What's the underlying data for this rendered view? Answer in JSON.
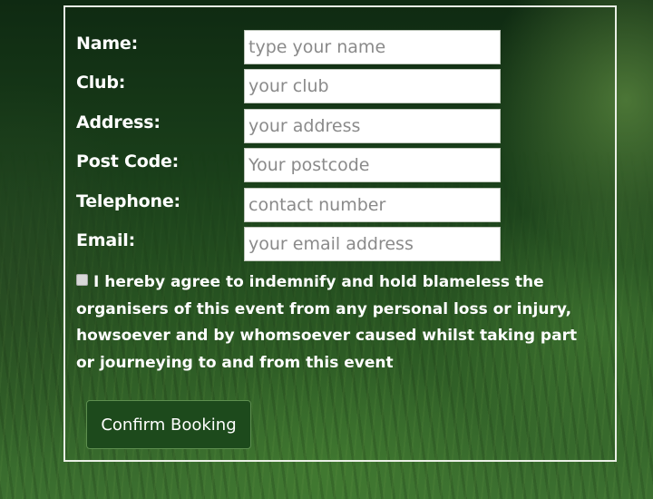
{
  "form": {
    "fields": [
      {
        "label": "Name:",
        "placeholder": "type your name"
      },
      {
        "label": "Club:",
        "placeholder": "your club"
      },
      {
        "label": "Address:",
        "placeholder": "your address"
      },
      {
        "label": "Post Code:",
        "placeholder": "Your postcode"
      },
      {
        "label": "Telephone:",
        "placeholder": "contact number"
      },
      {
        "label": "Email:",
        "placeholder": "your email address"
      }
    ],
    "agreement_text": "I hereby agree to indemnify and hold blameless the organisers of this event from any personal loss or injury, howsoever and by whomsoever caused whilst taking part or journeying to and from this event",
    "agreement_checked": false,
    "confirm_label": "Confirm Booking"
  }
}
